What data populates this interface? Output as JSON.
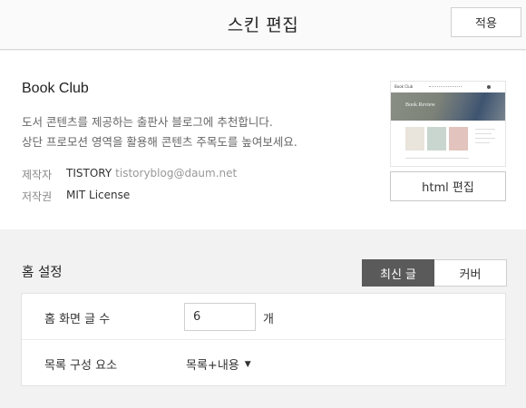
{
  "header": {
    "title": "스킨 편집",
    "apply_label": "적용"
  },
  "skin": {
    "name": "Book Club",
    "description_line1": "도서 콘텐츠를 제공하는 출판사 블로그에 추천합니다.",
    "description_line2": "상단 프로모션 영역을 활용해 콘텐츠 주목도를 높여보세요.",
    "author_label": "제작자",
    "author": "TISTORY",
    "author_email": "tistoryblog@daum.net",
    "license_label": "저작권",
    "license": "MIT License",
    "html_edit_label": "html 편집",
    "thumbnail": {
      "logo": "Book Club",
      "hero_text": "Book Review"
    }
  },
  "home_settings": {
    "title": "홈 설정",
    "tabs": [
      {
        "label": "최신 글",
        "active": true
      },
      {
        "label": "커버",
        "active": false
      }
    ],
    "post_count": {
      "label": "홈 화면 글 수",
      "value": "6",
      "unit": "개"
    },
    "list_composition": {
      "label": "목록 구성 요소",
      "selected": "목록+내용"
    }
  },
  "colors": {
    "tab_active_bg": "#5a5a5a",
    "page_bg": "#f2f2f2"
  }
}
